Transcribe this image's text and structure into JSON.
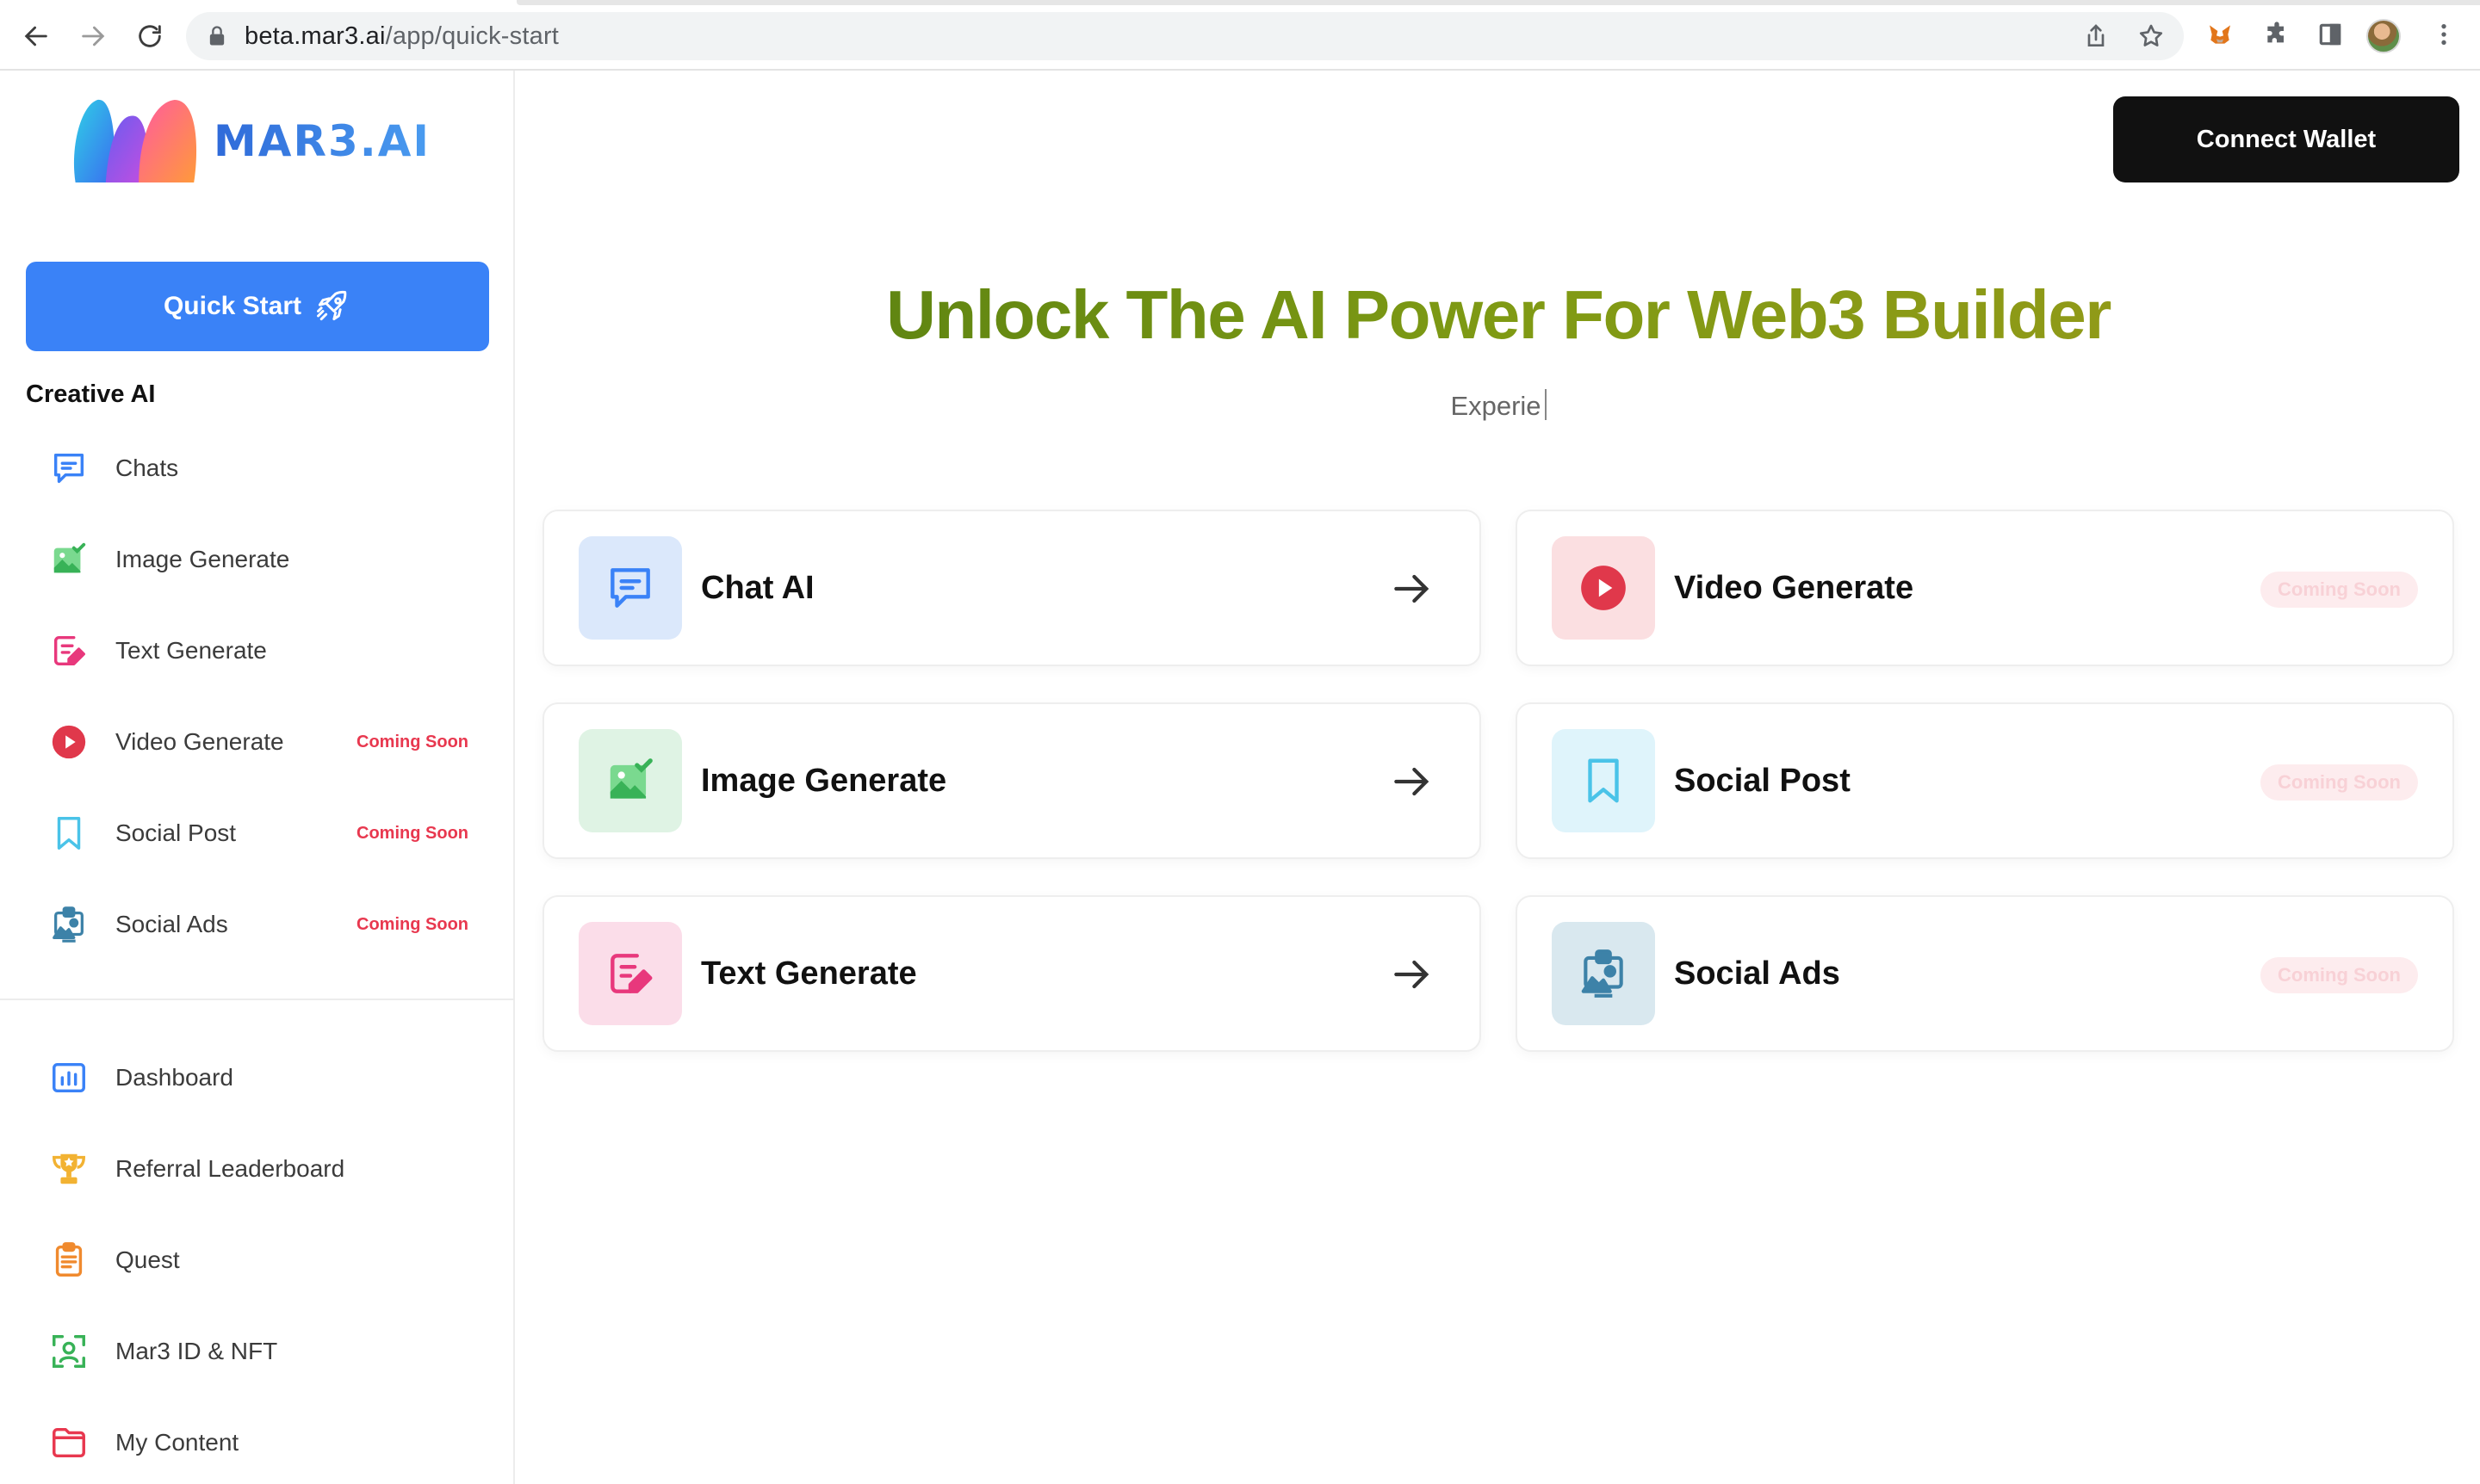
{
  "browser": {
    "url_host": "beta.mar3.ai",
    "url_path": "/app/quick-start"
  },
  "sidebar": {
    "logo_text": "MAR3.AI",
    "quick_start_label": "Quick Start",
    "section_title": "Creative AI",
    "creative_items": [
      {
        "label": "Chats",
        "icon": "chat-icon",
        "badge": ""
      },
      {
        "label": "Image Generate",
        "icon": "image-icon",
        "badge": ""
      },
      {
        "label": "Text Generate",
        "icon": "text-edit-icon",
        "badge": ""
      },
      {
        "label": "Video Generate",
        "icon": "play-icon",
        "badge": "Coming Soon"
      },
      {
        "label": "Social Post",
        "icon": "bookmark-icon",
        "badge": "Coming Soon"
      },
      {
        "label": "Social Ads",
        "icon": "ads-icon",
        "badge": "Coming Soon"
      }
    ],
    "other_items": [
      {
        "label": "Dashboard",
        "icon": "chart-icon"
      },
      {
        "label": "Referral Leaderboard",
        "icon": "trophy-icon"
      },
      {
        "label": "Quest",
        "icon": "clipboard-icon"
      },
      {
        "label": "Mar3 ID & NFT",
        "icon": "face-scan-icon"
      },
      {
        "label": "My Content",
        "icon": "folder-icon"
      }
    ]
  },
  "header": {
    "connect_label": "Connect Wallet"
  },
  "main": {
    "title": "Unlock The AI Power For Web3 Builder",
    "subtitle_typing": "Experie",
    "cards": [
      {
        "label": "Chat AI",
        "icon": "chat-icon",
        "status": "arrow"
      },
      {
        "label": "Video Generate",
        "icon": "play-icon",
        "status": "Coming Soon"
      },
      {
        "label": "Image Generate",
        "icon": "image-icon",
        "status": "arrow"
      },
      {
        "label": "Social Post",
        "icon": "bookmark-icon",
        "status": "Coming Soon"
      },
      {
        "label": "Text Generate",
        "icon": "text-edit-icon",
        "status": "arrow"
      },
      {
        "label": "Social Ads",
        "icon": "ads-icon",
        "status": "Coming Soon"
      }
    ]
  },
  "colors": {
    "primary_button": "#3a82f7",
    "coming_soon": "#e8384f",
    "title_gradient_start": "#4e7a10",
    "title_gradient_end": "#9a9a1a"
  }
}
